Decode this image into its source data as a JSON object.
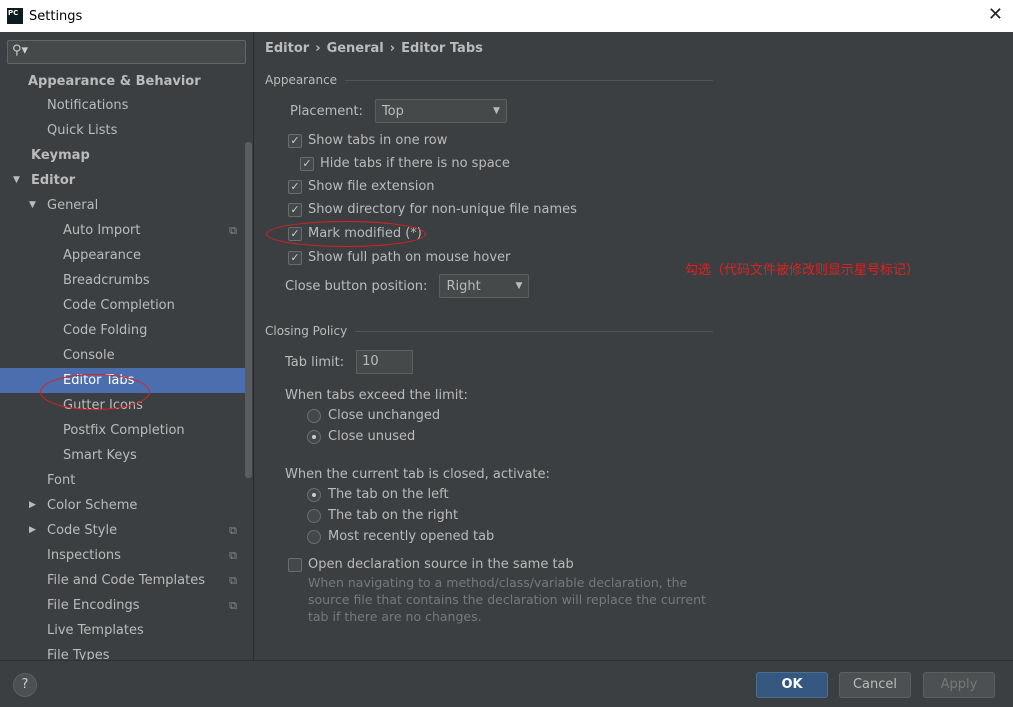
{
  "window": {
    "title": "Settings",
    "logo": "PC",
    "close": "✕"
  },
  "sidebar": {
    "items": [
      {
        "label": "Appearance & Behavior",
        "level": 0,
        "bold": true
      },
      {
        "label": "Notifications",
        "level": 1
      },
      {
        "label": "Quick Lists",
        "level": 1
      },
      {
        "label": "Keymap",
        "level": 0,
        "bold": true
      },
      {
        "label": "Editor",
        "level": 0,
        "bold": true,
        "expanded": true
      },
      {
        "label": "General",
        "level": 1,
        "expanded": true
      },
      {
        "label": "Auto Import",
        "level": 2,
        "copy": true
      },
      {
        "label": "Appearance",
        "level": 2
      },
      {
        "label": "Breadcrumbs",
        "level": 2
      },
      {
        "label": "Code Completion",
        "level": 2
      },
      {
        "label": "Code Folding",
        "level": 2
      },
      {
        "label": "Console",
        "level": 2
      },
      {
        "label": "Editor Tabs",
        "level": 2,
        "selected": true
      },
      {
        "label": "Gutter Icons",
        "level": 2
      },
      {
        "label": "Postfix Completion",
        "level": 2
      },
      {
        "label": "Smart Keys",
        "level": 2
      },
      {
        "label": "Font",
        "level": 1
      },
      {
        "label": "Color Scheme",
        "level": 1,
        "collapsed": true
      },
      {
        "label": "Code Style",
        "level": 1,
        "collapsed": true,
        "copy": true
      },
      {
        "label": "Inspections",
        "level": 1,
        "copy": true
      },
      {
        "label": "File and Code Templates",
        "level": 1,
        "copy": true
      },
      {
        "label": "File Encodings",
        "level": 1,
        "copy": true
      },
      {
        "label": "Live Templates",
        "level": 1
      },
      {
        "label": "File Types",
        "level": 1
      }
    ]
  },
  "breadcrumb": [
    "Editor",
    "›",
    "General",
    "›",
    "Editor Tabs"
  ],
  "appearance": {
    "title": "Appearance",
    "placement_label": "Placement:",
    "placement_value": "Top",
    "options": [
      {
        "label": "Show tabs in one row",
        "checked": true
      },
      {
        "label": "Hide tabs if there is no space",
        "checked": true
      },
      {
        "label": "Show file extension",
        "checked": true
      },
      {
        "label": "Show directory for non-unique file names",
        "checked": true
      },
      {
        "label": "Mark modified (*)",
        "checked": true
      },
      {
        "label": "Show full path on mouse hover",
        "checked": true
      }
    ],
    "close_btn_label": "Close button position:",
    "close_btn_value": "Right"
  },
  "annotation": "勾选（代码文件被修改则显示星号标记）",
  "closing": {
    "title": "Closing Policy",
    "tab_limit_label": "Tab limit:",
    "tab_limit_value": "10",
    "exceed_label": "When tabs exceed the limit:",
    "exceed_options": [
      {
        "label": "Close unchanged",
        "selected": false
      },
      {
        "label": "Close unused",
        "selected": true
      }
    ],
    "activate_label": "When the current tab is closed, activate:",
    "activate_options": [
      {
        "label": "The tab on the left",
        "selected": true
      },
      {
        "label": "The tab on the right",
        "selected": false
      },
      {
        "label": "Most recently opened tab",
        "selected": false
      }
    ],
    "open_decl_label": "Open declaration source in the same tab",
    "open_decl_checked": false,
    "open_decl_hint": "When navigating to a method/class/variable declaration, the source file that contains the declaration will replace the current tab if there are no changes."
  },
  "buttons": {
    "help": "?",
    "ok": "OK",
    "cancel": "Cancel",
    "apply": "Apply"
  }
}
